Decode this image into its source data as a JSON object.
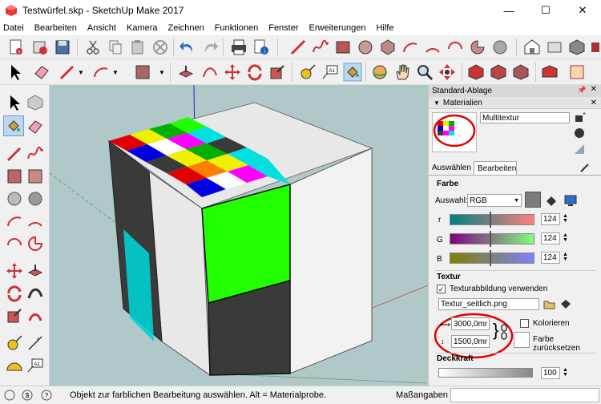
{
  "window": {
    "title": "Testwürfel.skp - SketchUp Make 2017",
    "minimize": "—",
    "maximize": "☐",
    "close": "✕"
  },
  "menu": [
    "Datei",
    "Bearbeiten",
    "Ansicht",
    "Kamera",
    "Zeichnen",
    "Funktionen",
    "Fenster",
    "Erweiterungen",
    "Hilfe"
  ],
  "panel": {
    "tray_title": "Standard-Ablage",
    "section_title": "Materialien",
    "material_name": "Multitextur",
    "tabs": [
      "Auswählen",
      "Bearbeiten"
    ],
    "active_tab": "Bearbeiten",
    "color_section": "Farbe",
    "color_mode_label": "Auswahl:",
    "color_mode_value": "RGB",
    "channels": [
      {
        "label": "r",
        "value": "124"
      },
      {
        "label": "G",
        "value": "124"
      },
      {
        "label": "B",
        "value": "124"
      }
    ],
    "texture_section": "Textur",
    "use_texture_label": "Texturabbildung verwenden",
    "use_texture_checked": true,
    "texture_file": "Textur_seitlich.png",
    "width_value": "3000,0mr",
    "height_value": "1500,0mr",
    "colorize_label": "Kolorieren",
    "reset_color_label": "Farbe zurücksetzen",
    "opacity_section": "Deckkraft",
    "opacity_value": "100"
  },
  "status": {
    "message": "Objekt zur farblichen Bearbeitung auswählen. Alt = Materialprobe.",
    "measure_label": "Maßangaben",
    "measure_value": ""
  },
  "colors": {
    "highlight_circle": "#e00000",
    "viewport_bg": "#b0c8c8",
    "green_face": "#22ff00",
    "cyan_face": "#00d0d0"
  }
}
